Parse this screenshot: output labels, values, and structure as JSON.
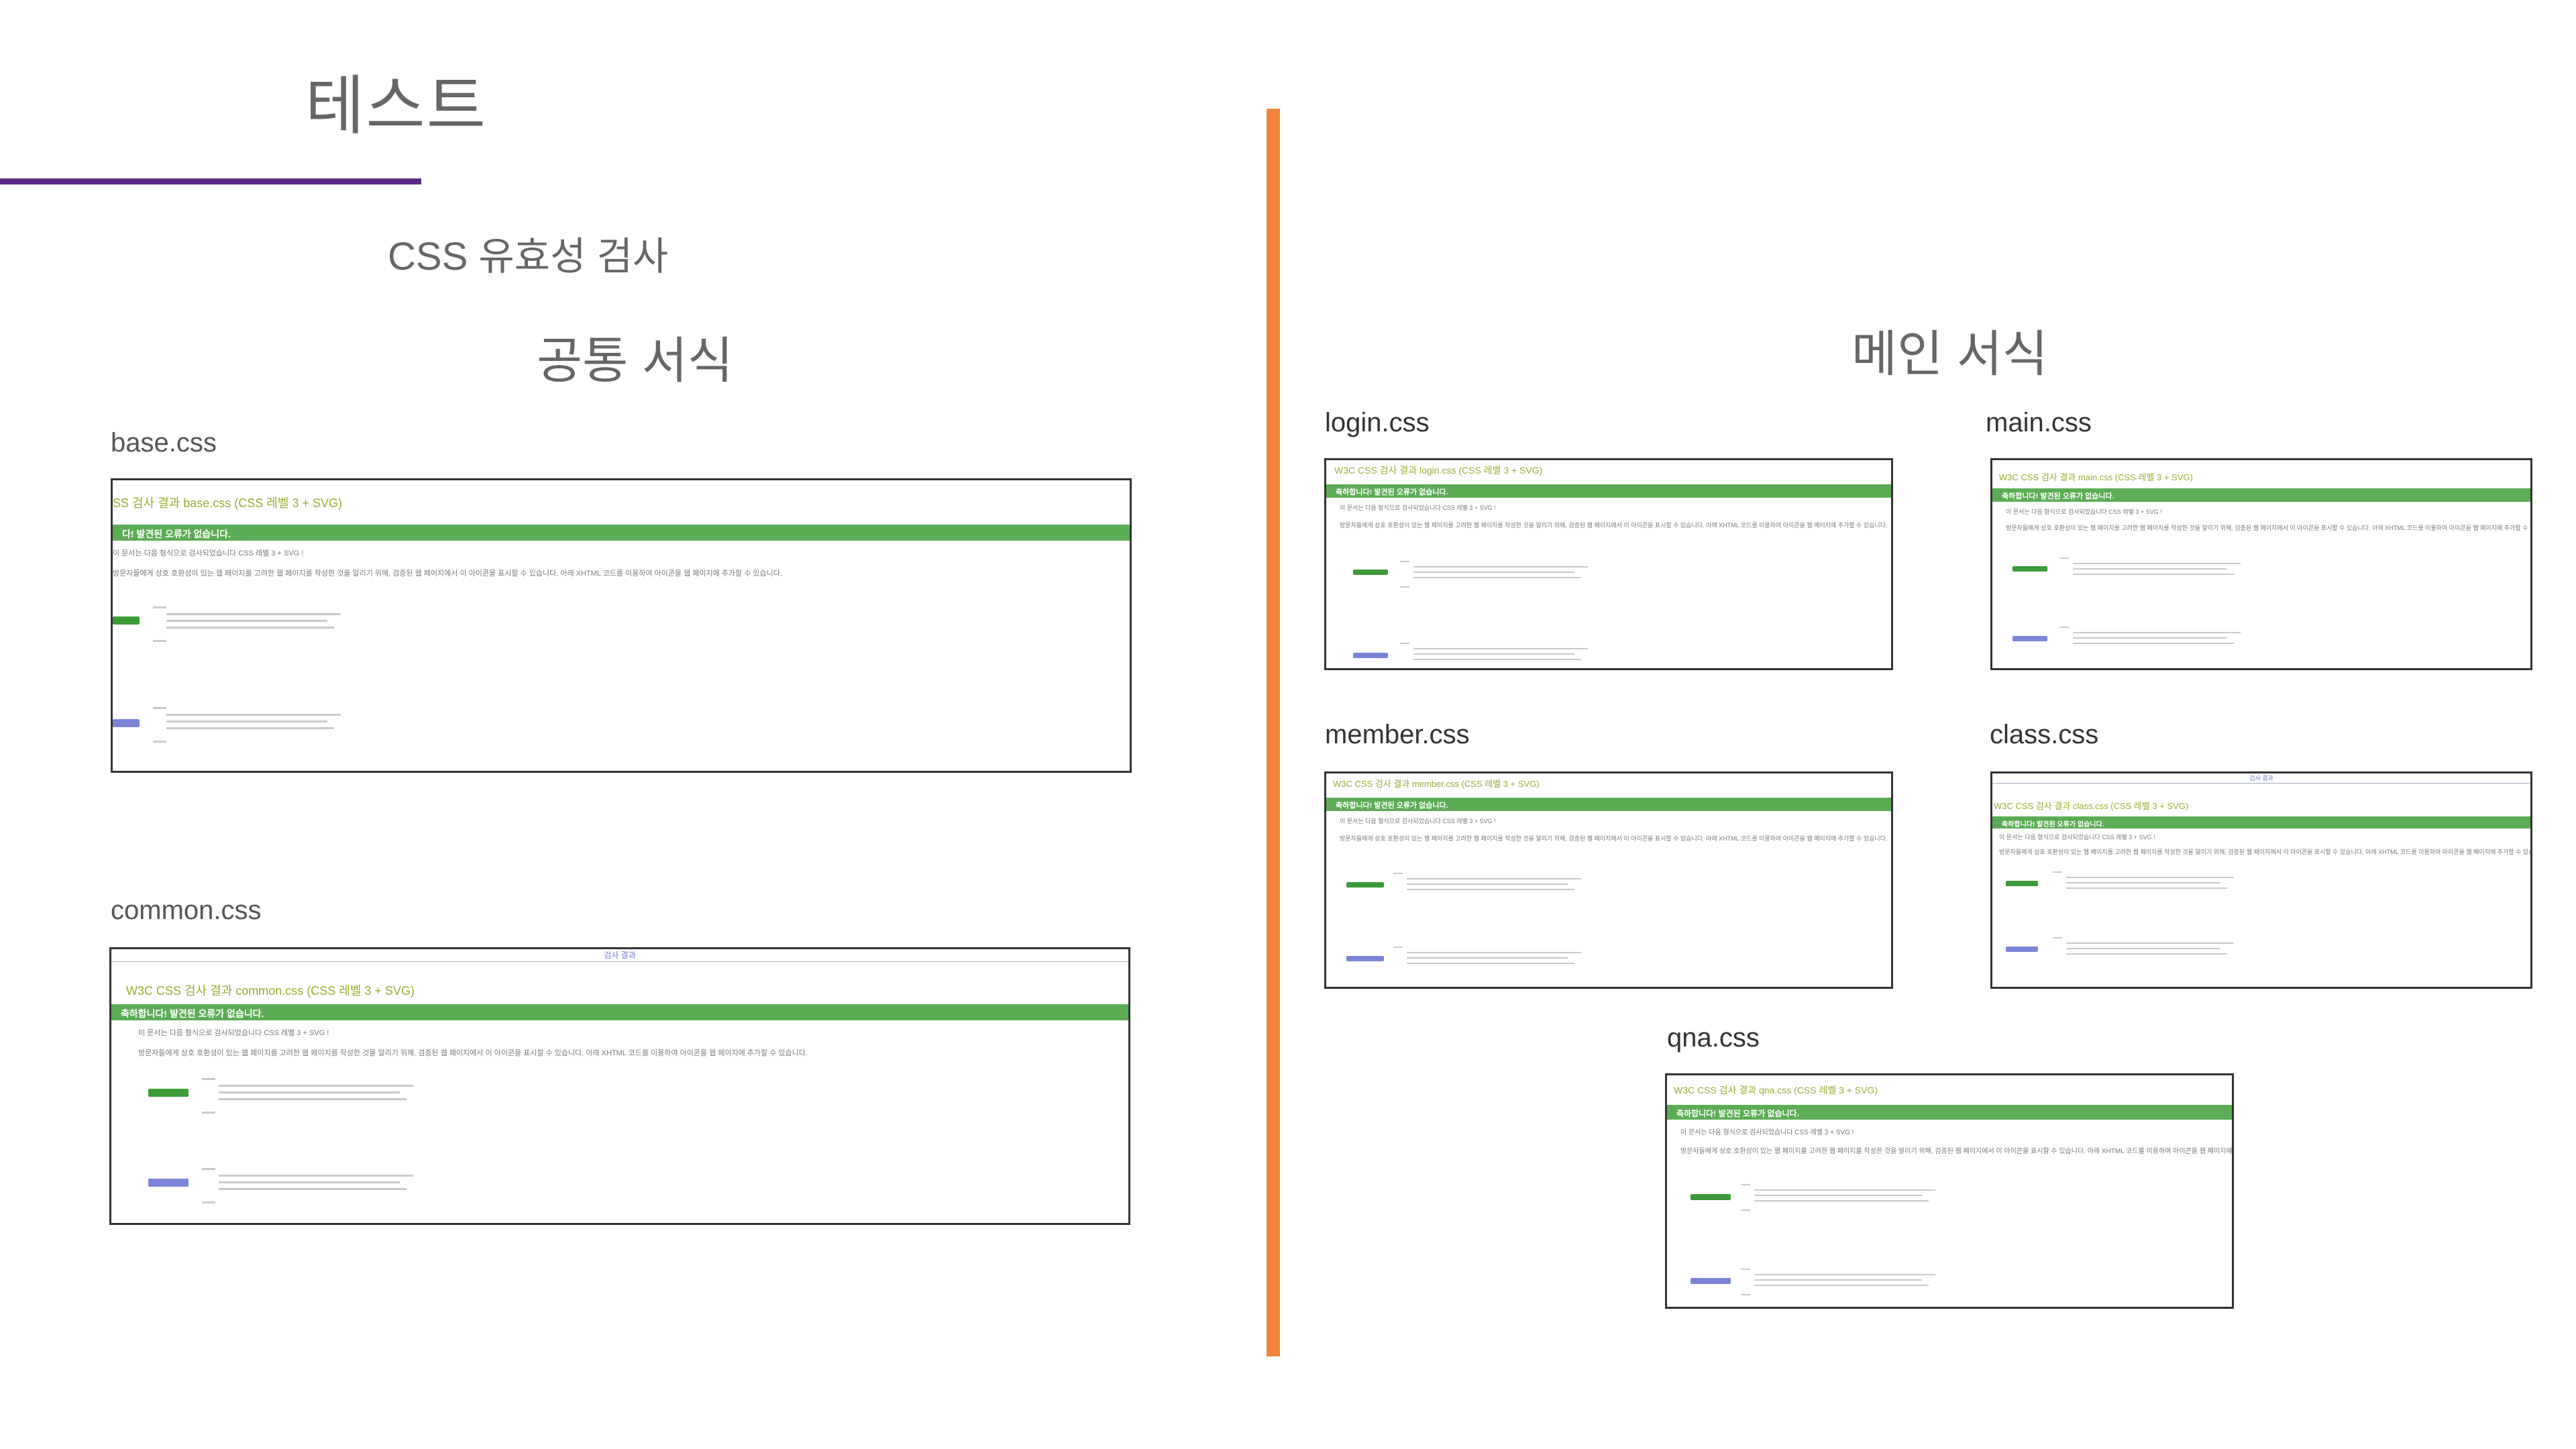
{
  "header": {
    "title": "테스트",
    "subtitle": "CSS 유효성 검사"
  },
  "sections": {
    "common": "공통 서식",
    "main": "메인 서식"
  },
  "files": {
    "base": "base.css",
    "common": "common.css",
    "login": "login.css",
    "main": "main.css",
    "member": "member.css",
    "class": "class.css",
    "qna": "qna.css"
  },
  "validator": {
    "nav": "검사 결과",
    "head_base": "SS 검사 결과 base.css (CSS 레벨 3 + SVG)",
    "head_common": "W3C CSS 검사 결과 common.css (CSS 레벨 3 + SVG)",
    "head_login": "W3C CSS 검사 결과 login.css (CSS 레벨 3 + SVG)",
    "head_main": "W3C CSS 검사 결과 main.css (CSS 레벨 3 + SVG)",
    "head_member": "W3C CSS 검사 결과 member.css (CSS 레벨 3 + SVG)",
    "head_class": "W3C CSS 검사 결과 class.css (CSS 레벨 3 + SVG)",
    "head_qna": "W3C CSS 검사 결과 qna.css (CSS 레벨 3 + SVG)",
    "success": "축하합니다! 발견된 오류가 없습니다.",
    "success_base": "다! 발견된 오류가 없습니다.",
    "line1": "이 문서는 다음 형식으로 검사되었습니다 CSS 레벨 3 + SVG !",
    "line2": "방문자들에게 상호 호환성이 있는 웹 페이지를 고려한 웹 페이지를 작성한 것을 알리기 위해, 검증된 웹 페이지에서 이 아이콘을 표시할 수 있습니다. 아래 XHTML 코드를 이용하여 아이콘을 웹 페이지에 추가할 수 있습니다."
  },
  "colors": {
    "accent_purple": "#5b2a86",
    "divider_orange": "#f0843a",
    "success_green": "#5cac55"
  }
}
